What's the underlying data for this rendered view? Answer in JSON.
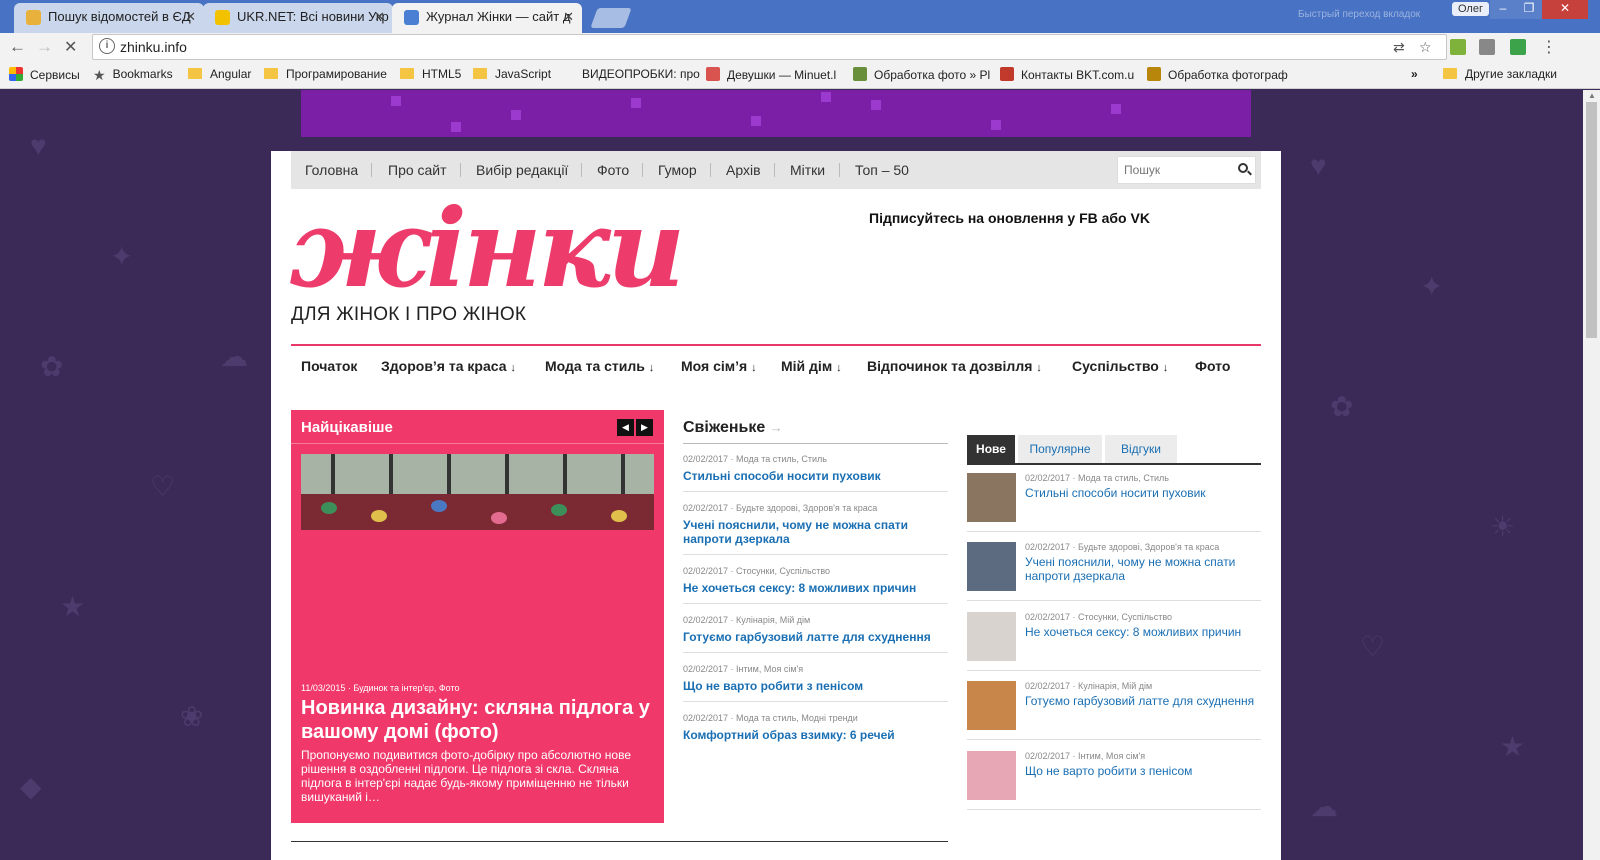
{
  "browser": {
    "tabs": [
      {
        "title": "Пошук відомостей в ЄД",
        "favicon_color": "#e8b13c"
      },
      {
        "title": "UKR.NET: Всі новини Укр",
        "favicon_color": "#f2c200"
      },
      {
        "title": "Журнал Жінки — сайт д",
        "favicon_color": "#4a7fd4"
      }
    ],
    "profile": "Олег",
    "dim_hint": "Быстрый переход вкладок",
    "url": "zhinku.info",
    "bookmarks": {
      "apps": "Сервисы",
      "items": [
        "Bookmarks",
        "Angular",
        "Програмирование",
        "HTML5",
        "JavaScript",
        "ВИДЕОПРОБКИ: про",
        "Девушки — Minuet.l",
        "Обработка фото » Pl",
        "Контакты BKT.com.u",
        "Обработка фотограф"
      ],
      "more": "»",
      "other": "Другие закладки"
    }
  },
  "site": {
    "topnav": [
      "Головна",
      "Про сайт",
      "Вибір редакції",
      "Фото",
      "Гумор",
      "Архів",
      "Мітки",
      "Топ – 50"
    ],
    "search_placeholder": "Пошук",
    "logo": "жінки",
    "tagline": "ДЛЯ ЖІНОК І ПРО ЖІНОК",
    "subscribe": "Підписуйтесь на оновлення у FB або VK",
    "brand_color": "#ed3b6b",
    "categories": [
      {
        "label": "Початок",
        "arrow": ""
      },
      {
        "label": "Здоров’я та краса",
        "arrow": "↓"
      },
      {
        "label": "Мода та стиль",
        "arrow": "↓"
      },
      {
        "label": "Моя сім’я",
        "arrow": "↓"
      },
      {
        "label": "Мій дім",
        "arrow": "↓"
      },
      {
        "label": "Відпочинок та дозвілля",
        "arrow": "↓"
      },
      {
        "label": "Суспільство",
        "arrow": "↓"
      },
      {
        "label": "Фото",
        "arrow": ""
      }
    ],
    "featured": {
      "title": "Найцікавіше",
      "prev": "◀",
      "next": "▶",
      "meta": "11/03/2015 · Будинок та інтер'єр, Фото",
      "headline": "Новинка дизайну: скляна підлога у вашому домі (фото)",
      "excerpt": "Пропонуємо подивитися фото-добірку про абсолютно нове рішення в оздобленні підлоги. Це підлога зі скла. Скляна підлога в інтер'єрі надає будь-якому приміщенню не тільки вишуканий і…"
    },
    "fresh": {
      "title": "Свіженьке",
      "arrow": "→",
      "items": [
        {
          "meta": "02/02/2017 · Мода та стиль, Стиль",
          "title": "Стильні способи носити пуховик"
        },
        {
          "meta": "02/02/2017 · Будьте здорові, Здоров'я та краса",
          "title": "Учені пояснили, чому не можна спати напроти дзеркала"
        },
        {
          "meta": "02/02/2017 · Стосунки, Суспільство",
          "title": "Не хочеться сексу: 8 можливих причин"
        },
        {
          "meta": "02/02/2017 · Кулінарія, Мій дім",
          "title": "Готуємо гарбузовий латте для схуднення"
        },
        {
          "meta": "02/02/2017 · Інтим, Моя сім'я",
          "title": "Що не варто робити з пенісом"
        },
        {
          "meta": "02/02/2017 · Мода та стиль, Модні тренди",
          "title": "Комфортний образ взимку: 6 речей"
        }
      ]
    },
    "tabs": {
      "labels": [
        "Нове",
        "Популярне",
        "Відгуки"
      ],
      "items": [
        {
          "meta": "02/02/2017 · Мода та стиль, Стиль",
          "title": "Стильні способи носити пуховик",
          "thumb": "#8a7560"
        },
        {
          "meta": "02/02/2017 · Будьте здорові, Здоров'я та краса",
          "title": "Учені пояснили, чому не можна спати напроти дзеркала",
          "thumb": "#5d6b80"
        },
        {
          "meta": "02/02/2017 · Стосунки, Суспільство",
          "title": "Не хочеться сексу: 8 можливих причин",
          "thumb": "#d8d3cf"
        },
        {
          "meta": "02/02/2017 · Кулінарія, Мій дім",
          "title": "Готуємо гарбузовий латте для схуднення",
          "thumb": "#c8864a"
        },
        {
          "meta": "02/02/2017 · Інтим, Моя сім'я",
          "title": "Що не варто робити з пенісом",
          "thumb": "#e7a7b4"
        }
      ]
    }
  }
}
